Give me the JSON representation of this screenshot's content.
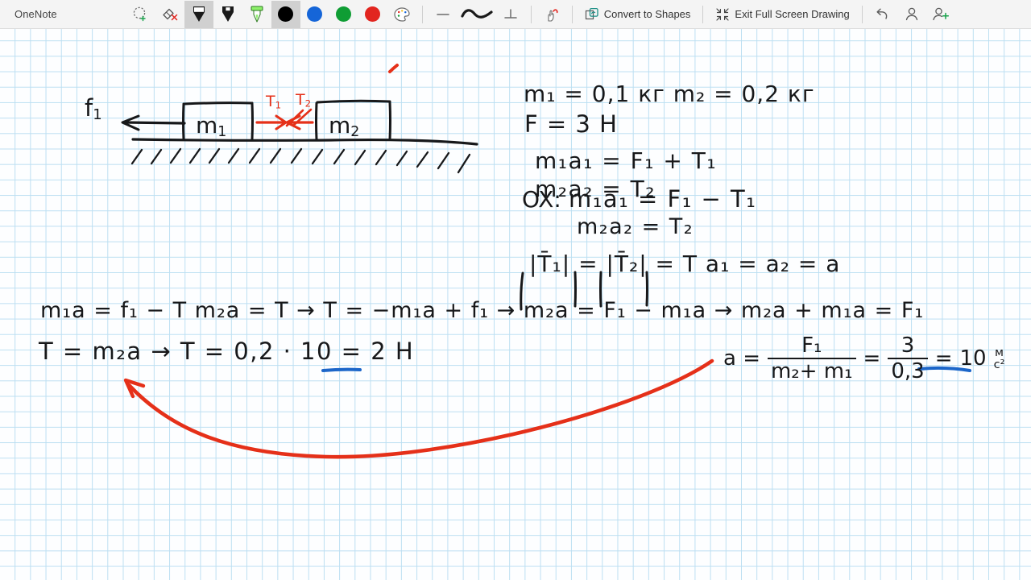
{
  "toolbar": {
    "app_title": "OneNote",
    "tools": [
      {
        "name": "lasso-select-tool",
        "icon": "lasso-select-icon",
        "selected": false
      },
      {
        "name": "eraser-tool",
        "icon": "eraser-icon",
        "selected": false
      },
      {
        "name": "pen-thin-tool",
        "icon": "pen-icon",
        "selected": true
      },
      {
        "name": "pen-thick-tool",
        "icon": "pen-thick-icon",
        "selected": false
      },
      {
        "name": "highlighter-tool",
        "icon": "highlighter-icon",
        "selected": false
      }
    ],
    "colors": [
      {
        "name": "color-black",
        "hex": "#000000",
        "selected": true
      },
      {
        "name": "color-blue",
        "hex": "#1565d8",
        "selected": false
      },
      {
        "name": "color-green",
        "hex": "#0f9d34",
        "selected": false
      },
      {
        "name": "color-red",
        "hex": "#e2251f",
        "selected": false
      }
    ],
    "palette_icon": "color-palette-icon",
    "shape_tools": [
      {
        "name": "line-tool",
        "icon": "line-icon"
      },
      {
        "name": "curve-tool",
        "icon": "wave-icon"
      },
      {
        "name": "perpendicular-tool",
        "icon": "perpendicular-icon"
      }
    ],
    "gesture_icon": "ink-gesture-icon",
    "convert_to_shapes": {
      "label": "Convert to Shapes",
      "icon": "convert-shapes-icon"
    },
    "exit_full_screen": {
      "label": "Exit Full Screen Drawing",
      "icon": "collapse-arrows-icon"
    },
    "undo": {
      "icon": "undo-icon"
    },
    "account": {
      "icon": "person-icon"
    },
    "share": {
      "icon": "person-add-icon"
    }
  },
  "canvas": {
    "grid_color": "#bcdff2",
    "ink_black": "#17181a",
    "ink_red": "#e53019",
    "ink_blue": "#1c66c9",
    "notes": [
      {
        "id": "friction-label",
        "text": "f",
        "sub": "1"
      },
      {
        "id": "block-1-label",
        "text": "m",
        "sub": "1"
      },
      {
        "id": "block-2-label",
        "text": "m",
        "sub": "2"
      },
      {
        "id": "tension-1-label",
        "text": "T",
        "sub": "1"
      },
      {
        "id": "tension-2-label",
        "text": "T",
        "sub": "2"
      }
    ],
    "equations": {
      "given_masses": "m₁ = 0,1 кг     m₂ = 0,2 кг",
      "given_force": "F = 3 H",
      "newton_1": "m₁a₁ = F₁ + T₁",
      "newton_2": "m₂a₂ = T₂",
      "ox_label": "OX:",
      "ox_1": "m₁a₁ = F₁ − T₁",
      "ox_2": "m₂a₂ = T₂",
      "tension_equal": "|T̄₁| = |T̄₂| = T     a₁ = a₂ = a",
      "derivation": "m₁a = f₁ − T     m₂a = T  →   T = −m₁a + f₁  →  m₂a = F₁ − m₁a  →  m₂a + m₁a = F₁",
      "result_T": "T = m₂a   →   T =  0,2 · 10 = 2 H",
      "accel_lhs": "a =",
      "accel_num": "F₁",
      "accel_den": "m₂+ m₁",
      "accel_eq2_num": "3",
      "accel_eq2_den": "0,3",
      "accel_value": "10",
      "accel_unit_num": "м",
      "accel_unit_den": "с²"
    }
  }
}
